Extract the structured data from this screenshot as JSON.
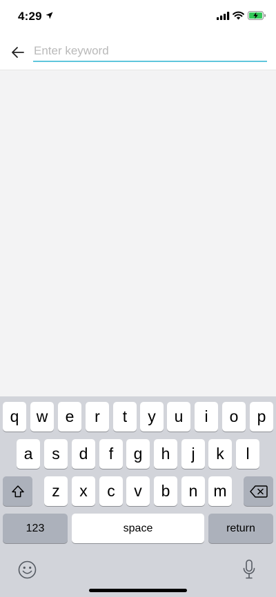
{
  "status_bar": {
    "time": "4:29",
    "icons": [
      "location-arrow-icon",
      "cellular-signal-icon",
      "wifi-icon",
      "battery-charging-icon"
    ]
  },
  "search": {
    "placeholder": "Enter keyword",
    "value": "",
    "underline_color": "#5fc6dc",
    "back_icon": "back-arrow-icon"
  },
  "keyboard": {
    "row1": [
      "q",
      "w",
      "e",
      "r",
      "t",
      "y",
      "u",
      "i",
      "o",
      "p"
    ],
    "row2": [
      "a",
      "s",
      "d",
      "f",
      "g",
      "h",
      "j",
      "k",
      "l"
    ],
    "row3": [
      "z",
      "x",
      "c",
      "v",
      "b",
      "n",
      "m"
    ],
    "numbers_label": "123",
    "space_label": "space",
    "return_label": "return",
    "icons": [
      "shift-icon",
      "delete-icon",
      "emoji-icon",
      "microphone-icon"
    ]
  }
}
